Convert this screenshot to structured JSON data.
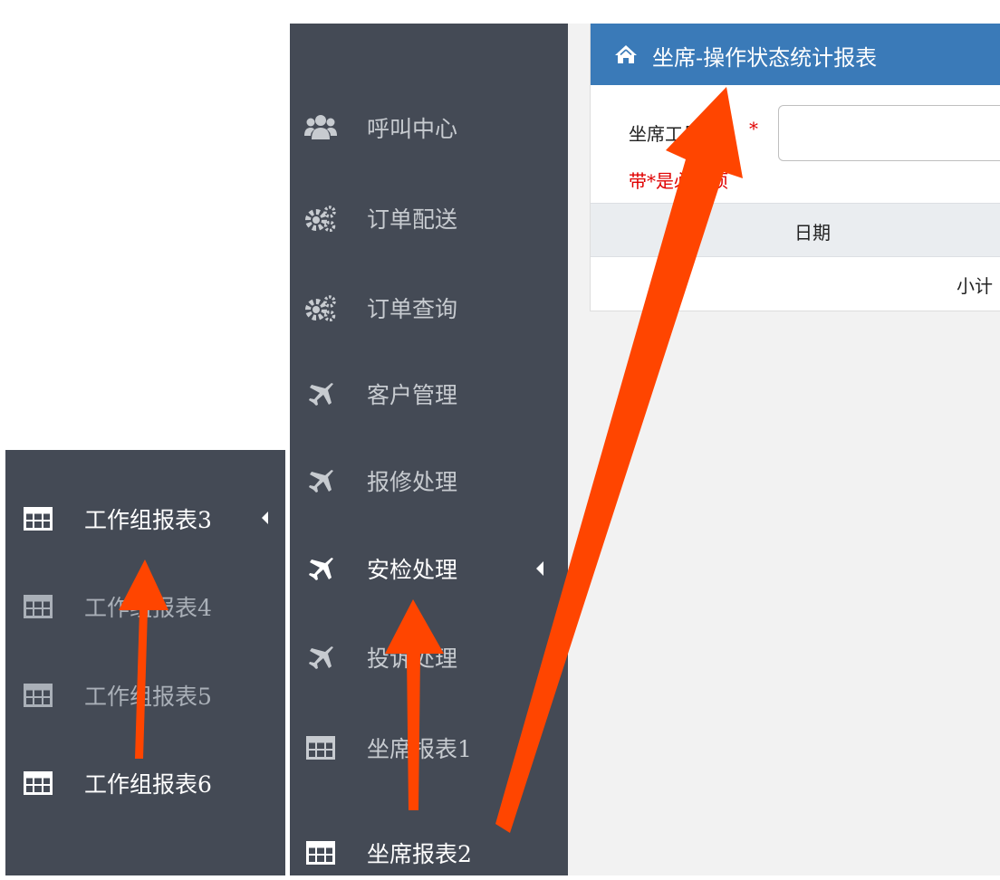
{
  "sidebar": {
    "items": [
      {
        "label": "呼叫中心",
        "icon": "users-icon"
      },
      {
        "label": "订单配送",
        "icon": "gears-icon"
      },
      {
        "label": "订单查询",
        "icon": "gears-icon"
      },
      {
        "label": "客户管理",
        "icon": "plane-icon"
      },
      {
        "label": "报修处理",
        "icon": "plane-icon"
      },
      {
        "label": "安检处理",
        "icon": "plane-icon",
        "active": true
      },
      {
        "label": "投诉处理",
        "icon": "plane-icon"
      },
      {
        "label": "坐席报表1",
        "icon": "table-icon"
      },
      {
        "label": "坐席报表2",
        "icon": "table-icon",
        "active": true
      }
    ]
  },
  "sub_sidebar": {
    "items": [
      {
        "label": "工作组报表3",
        "icon": "table-icon",
        "active": true
      },
      {
        "label": "工作组报表4",
        "icon": "table-icon"
      },
      {
        "label": "工作组报表5",
        "icon": "table-icon"
      },
      {
        "label": "工作组报表6",
        "icon": "table-icon",
        "active": true
      }
    ]
  },
  "panel": {
    "icon": "home-icon",
    "title": "坐席-操作状态统计报表",
    "field_label": "坐席工号",
    "required_star": "*",
    "input_value": "",
    "required_note": "带*是必填项",
    "table": {
      "columns": [
        "日期"
      ],
      "rows": [
        [
          "小计"
        ]
      ]
    }
  },
  "colors": {
    "sidebar_bg": "#444a55",
    "header_blue": "#3a7ab8",
    "content_bg": "#f2f2f2",
    "arrow": "#ff4500",
    "required_red": "#e00000"
  }
}
